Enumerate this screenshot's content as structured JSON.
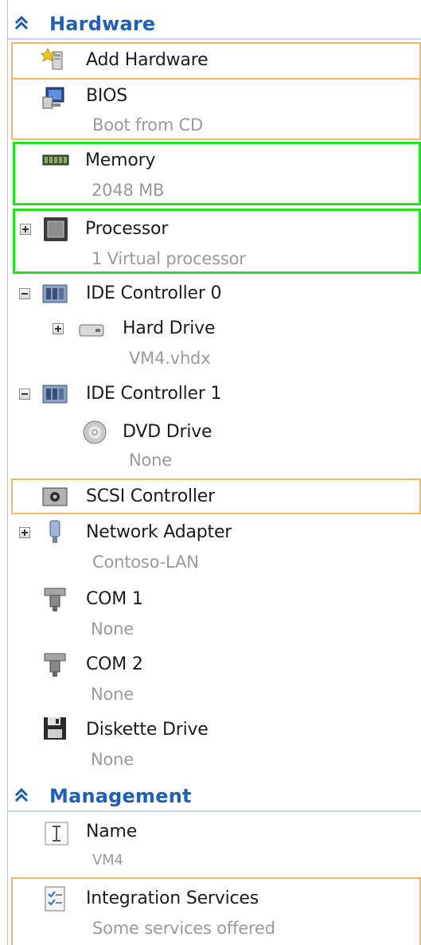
{
  "hardware": {
    "title": "Hardware",
    "add_hardware": "Add Hardware",
    "bios": {
      "label": "BIOS",
      "sub": "Boot from CD"
    },
    "memory": {
      "label": "Memory",
      "sub": "2048 MB"
    },
    "processor": {
      "label": "Processor",
      "sub": "1 Virtual processor"
    },
    "ide0": {
      "label": "IDE Controller 0"
    },
    "hard_drive": {
      "label": "Hard Drive",
      "sub": "VM4.vhdx"
    },
    "ide1": {
      "label": "IDE Controller 1"
    },
    "dvd_drive": {
      "label": "DVD Drive",
      "sub": "None"
    },
    "scsi": {
      "label": "SCSI Controller"
    },
    "network": {
      "label": "Network Adapter",
      "sub": "Contoso-LAN"
    },
    "com1": {
      "label": "COM 1",
      "sub": "None"
    },
    "com2": {
      "label": "COM 2",
      "sub": "None"
    },
    "diskette": {
      "label": "Diskette Drive",
      "sub": "None"
    }
  },
  "management": {
    "title": "Management",
    "name": {
      "label": "Name",
      "sub": "VM4"
    },
    "integration": {
      "label": "Integration Services",
      "sub": "Some services offered"
    }
  },
  "icons": {
    "section_collapse": "double-chevron-up-icon",
    "add_hardware": "add-hardware-icon",
    "bios": "bios-monitor-icon",
    "memory": "memory-chip-icon",
    "processor": "processor-icon",
    "ide": "ide-controller-icon",
    "hard_drive": "hard-drive-icon",
    "dvd": "dvd-disc-icon",
    "scsi": "scsi-controller-icon",
    "network": "network-adapter-icon",
    "com": "com-port-icon",
    "diskette": "floppy-disk-icon",
    "name": "text-cursor-icon",
    "integration": "checklist-icon"
  },
  "colors": {
    "section_title": "#1f5fb5",
    "highlight_orange": "#f0b46a",
    "highlight_green": "#22e022",
    "subtext": "#9a9a9a"
  }
}
